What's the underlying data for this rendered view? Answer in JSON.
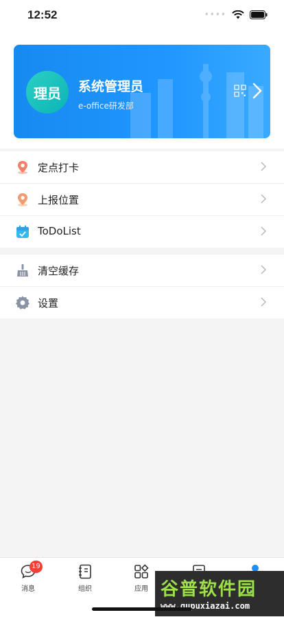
{
  "status_bar": {
    "time": "12:52"
  },
  "profile": {
    "avatar_text": "理员",
    "name": "系统管理员",
    "department": "e-office研发部"
  },
  "menu_group1": [
    {
      "label": "定点打卡",
      "icon": "location-pin-icon"
    },
    {
      "label": "上报位置",
      "icon": "location-report-icon"
    },
    {
      "label": "ToDoList",
      "icon": "calendar-icon"
    }
  ],
  "menu_group2": [
    {
      "label": "清空缓存",
      "icon": "broom-icon"
    },
    {
      "label": "设置",
      "icon": "gear-icon"
    }
  ],
  "tabbar": {
    "messages": {
      "label": "消息",
      "badge": "19"
    },
    "org": {
      "label": "组织"
    },
    "apps": {
      "label": "应用"
    }
  },
  "watermark": {
    "title": "谷普软件园",
    "url": "www.gupuxiazai.com"
  },
  "colors": {
    "card_blue": "#1f97ff",
    "badge_red": "#f04134",
    "avatar_teal": "#12c1bc"
  }
}
